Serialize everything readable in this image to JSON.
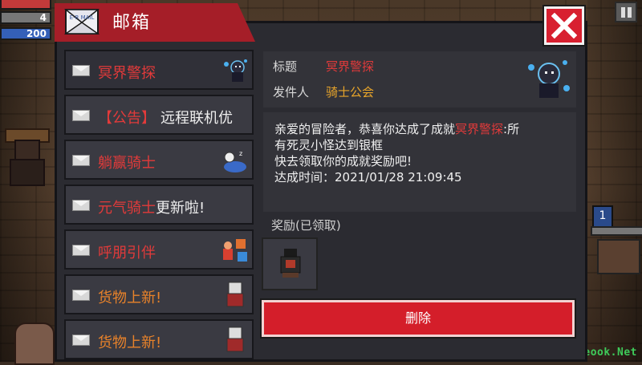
{
  "hud": {
    "hp": "",
    "armor": "4",
    "energy": "200"
  },
  "dialog": {
    "title": "邮箱",
    "mail_icon_text": "E-R MAIL"
  },
  "mail_list": [
    {
      "prefix": "",
      "title": "冥界警探",
      "color": "red",
      "thumb": "ghost-detective-icon"
    },
    {
      "prefix": "【公告】",
      "title": "远程联机优",
      "color": "white",
      "thumb": ""
    },
    {
      "prefix": "",
      "title": "躺赢骑士",
      "color": "red",
      "thumb": "sleeping-knight-icon"
    },
    {
      "prefix": "元气骑士",
      "title": "更新啦!",
      "color": "white",
      "thumb": ""
    },
    {
      "prefix": "",
      "title": "呼朋引伴",
      "color": "red",
      "thumb": "friends-icon"
    },
    {
      "prefix": "",
      "title": "货物上新!",
      "color": "orange",
      "thumb": "merchant-icon"
    },
    {
      "prefix": "",
      "title": "货物上新!",
      "color": "orange",
      "thumb": "merchant-icon"
    }
  ],
  "detail": {
    "subject_label": "标题",
    "subject_value": "冥界警探",
    "sender_label": "发件人",
    "sender_value": "骑士公会",
    "body_line1_a": "亲爱的冒险者，恭喜你达成了成就",
    "body_line1_b": "冥界警探",
    "body_line1_c": ":所",
    "body_line2": "有死灵小怪达到银框",
    "body_line3": "快去领取你的成就奖励吧!",
    "body_line4": "达成时间：2021/01/28 21:09:45",
    "reward_label": "奖励(已领取)",
    "delete_label": "删除"
  },
  "side": {
    "badge": "1"
  },
  "watermark": "Eeook.Net",
  "colors": {
    "red": "#e23a3a",
    "orange": "#e8822a",
    "accent": "#d41e2a"
  }
}
